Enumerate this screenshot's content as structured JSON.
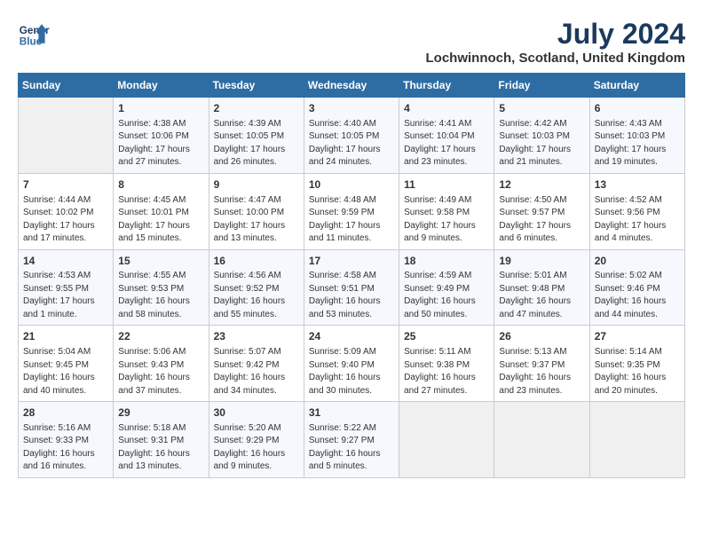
{
  "header": {
    "logo_line1": "General",
    "logo_line2": "Blue",
    "month": "July 2024",
    "location": "Lochwinnoch, Scotland, United Kingdom"
  },
  "days_of_week": [
    "Sunday",
    "Monday",
    "Tuesday",
    "Wednesday",
    "Thursday",
    "Friday",
    "Saturday"
  ],
  "weeks": [
    [
      {
        "day": "",
        "content": ""
      },
      {
        "day": "1",
        "content": "Sunrise: 4:38 AM\nSunset: 10:06 PM\nDaylight: 17 hours and 27 minutes."
      },
      {
        "day": "2",
        "content": "Sunrise: 4:39 AM\nSunset: 10:05 PM\nDaylight: 17 hours and 26 minutes."
      },
      {
        "day": "3",
        "content": "Sunrise: 4:40 AM\nSunset: 10:05 PM\nDaylight: 17 hours and 24 minutes."
      },
      {
        "day": "4",
        "content": "Sunrise: 4:41 AM\nSunset: 10:04 PM\nDaylight: 17 hours and 23 minutes."
      },
      {
        "day": "5",
        "content": "Sunrise: 4:42 AM\nSunset: 10:03 PM\nDaylight: 17 hours and 21 minutes."
      },
      {
        "day": "6",
        "content": "Sunrise: 4:43 AM\nSunset: 10:03 PM\nDaylight: 17 hours and 19 minutes."
      }
    ],
    [
      {
        "day": "7",
        "content": "Sunrise: 4:44 AM\nSunset: 10:02 PM\nDaylight: 17 hours and 17 minutes."
      },
      {
        "day": "8",
        "content": "Sunrise: 4:45 AM\nSunset: 10:01 PM\nDaylight: 17 hours and 15 minutes."
      },
      {
        "day": "9",
        "content": "Sunrise: 4:47 AM\nSunset: 10:00 PM\nDaylight: 17 hours and 13 minutes."
      },
      {
        "day": "10",
        "content": "Sunrise: 4:48 AM\nSunset: 9:59 PM\nDaylight: 17 hours and 11 minutes."
      },
      {
        "day": "11",
        "content": "Sunrise: 4:49 AM\nSunset: 9:58 PM\nDaylight: 17 hours and 9 minutes."
      },
      {
        "day": "12",
        "content": "Sunrise: 4:50 AM\nSunset: 9:57 PM\nDaylight: 17 hours and 6 minutes."
      },
      {
        "day": "13",
        "content": "Sunrise: 4:52 AM\nSunset: 9:56 PM\nDaylight: 17 hours and 4 minutes."
      }
    ],
    [
      {
        "day": "14",
        "content": "Sunrise: 4:53 AM\nSunset: 9:55 PM\nDaylight: 17 hours and 1 minute."
      },
      {
        "day": "15",
        "content": "Sunrise: 4:55 AM\nSunset: 9:53 PM\nDaylight: 16 hours and 58 minutes."
      },
      {
        "day": "16",
        "content": "Sunrise: 4:56 AM\nSunset: 9:52 PM\nDaylight: 16 hours and 55 minutes."
      },
      {
        "day": "17",
        "content": "Sunrise: 4:58 AM\nSunset: 9:51 PM\nDaylight: 16 hours and 53 minutes."
      },
      {
        "day": "18",
        "content": "Sunrise: 4:59 AM\nSunset: 9:49 PM\nDaylight: 16 hours and 50 minutes."
      },
      {
        "day": "19",
        "content": "Sunrise: 5:01 AM\nSunset: 9:48 PM\nDaylight: 16 hours and 47 minutes."
      },
      {
        "day": "20",
        "content": "Sunrise: 5:02 AM\nSunset: 9:46 PM\nDaylight: 16 hours and 44 minutes."
      }
    ],
    [
      {
        "day": "21",
        "content": "Sunrise: 5:04 AM\nSunset: 9:45 PM\nDaylight: 16 hours and 40 minutes."
      },
      {
        "day": "22",
        "content": "Sunrise: 5:06 AM\nSunset: 9:43 PM\nDaylight: 16 hours and 37 minutes."
      },
      {
        "day": "23",
        "content": "Sunrise: 5:07 AM\nSunset: 9:42 PM\nDaylight: 16 hours and 34 minutes."
      },
      {
        "day": "24",
        "content": "Sunrise: 5:09 AM\nSunset: 9:40 PM\nDaylight: 16 hours and 30 minutes."
      },
      {
        "day": "25",
        "content": "Sunrise: 5:11 AM\nSunset: 9:38 PM\nDaylight: 16 hours and 27 minutes."
      },
      {
        "day": "26",
        "content": "Sunrise: 5:13 AM\nSunset: 9:37 PM\nDaylight: 16 hours and 23 minutes."
      },
      {
        "day": "27",
        "content": "Sunrise: 5:14 AM\nSunset: 9:35 PM\nDaylight: 16 hours and 20 minutes."
      }
    ],
    [
      {
        "day": "28",
        "content": "Sunrise: 5:16 AM\nSunset: 9:33 PM\nDaylight: 16 hours and 16 minutes."
      },
      {
        "day": "29",
        "content": "Sunrise: 5:18 AM\nSunset: 9:31 PM\nDaylight: 16 hours and 13 minutes."
      },
      {
        "day": "30",
        "content": "Sunrise: 5:20 AM\nSunset: 9:29 PM\nDaylight: 16 hours and 9 minutes."
      },
      {
        "day": "31",
        "content": "Sunrise: 5:22 AM\nSunset: 9:27 PM\nDaylight: 16 hours and 5 minutes."
      },
      {
        "day": "",
        "content": ""
      },
      {
        "day": "",
        "content": ""
      },
      {
        "day": "",
        "content": ""
      }
    ]
  ]
}
